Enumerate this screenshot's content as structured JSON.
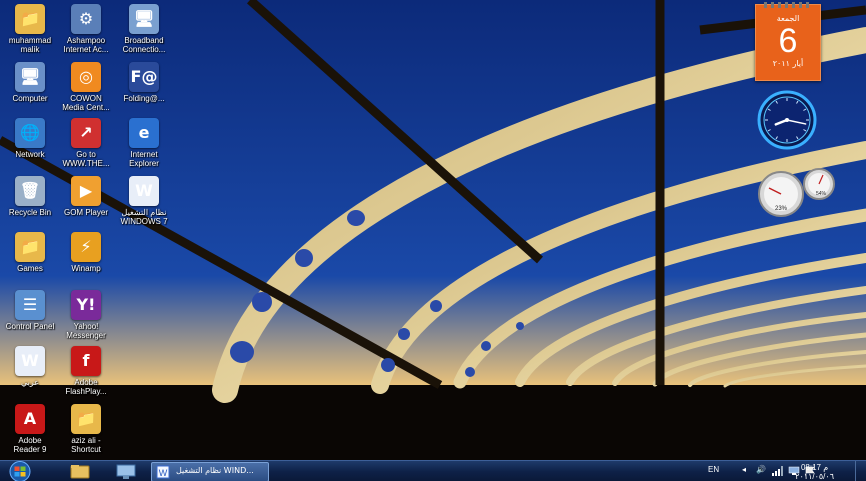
{
  "desktop": {
    "icons": [
      {
        "name": "user-folder",
        "label": "muhammad\nmalik",
        "icon": "folder-icon",
        "color": "#e8b84a",
        "glyph": "📁"
      },
      {
        "name": "ashampoo",
        "label": "Ashampoo\nInternet Ac...",
        "icon": "ashampoo-icon",
        "color": "#5a7fb8",
        "glyph": "⚙"
      },
      {
        "name": "broadband",
        "label": "Broadband\nConnectio...",
        "icon": "network-connection-icon",
        "color": "#7aa0d0",
        "glyph": "🖥"
      },
      {
        "name": "computer",
        "label": "Computer",
        "icon": "computer-icon",
        "color": "#6a90c8",
        "glyph": "🖥"
      },
      {
        "name": "cowon",
        "label": "COWON\nMedia Cent...",
        "icon": "cowon-icon",
        "color": "#f08a20",
        "glyph": "◎"
      },
      {
        "name": "folding",
        "label": "Folding@...",
        "icon": "folding-icon",
        "color": "#2a4a9a",
        "glyph": "F@"
      },
      {
        "name": "network",
        "label": "Network",
        "icon": "network-icon",
        "color": "#3a7ac8",
        "glyph": "🌐"
      },
      {
        "name": "goto-the",
        "label": "Go to\nWWW.THE...",
        "icon": "shortcut-icon",
        "color": "#d03030",
        "glyph": "↗"
      },
      {
        "name": "internet-explorer",
        "label": "Internet\nExplorer",
        "icon": "internet-explorer-icon",
        "color": "#2a70d0",
        "glyph": "e"
      },
      {
        "name": "recycle-bin",
        "label": "Recycle Bin",
        "icon": "recycle-bin-icon",
        "color": "#9ab0c8",
        "glyph": "🗑"
      },
      {
        "name": "gom-player",
        "label": "GOM Player",
        "icon": "gom-player-icon",
        "color": "#f0a030",
        "glyph": "▶"
      },
      {
        "name": "windows7-doc",
        "label": "نظام التشغيل\nWINDOWS 7",
        "icon": "document-icon",
        "color": "#e8eef8",
        "glyph": "W"
      },
      {
        "name": "games",
        "label": "Games",
        "icon": "folder-icon",
        "color": "#e8b84a",
        "glyph": "📁"
      },
      {
        "name": "winamp",
        "label": "Winamp",
        "icon": "winamp-icon",
        "color": "#e8a020",
        "glyph": "⚡"
      },
      {
        "name": "control-panel",
        "label": "Control Panel",
        "icon": "control-panel-icon",
        "color": "#5a90d0",
        "glyph": "☰"
      },
      {
        "name": "yahoo-messenger",
        "label": "Yahoo!\nMessenger",
        "icon": "yahoo-messenger-icon",
        "color": "#7a2a9a",
        "glyph": "Y!"
      },
      {
        "name": "arabic-doc",
        "label": "عربي",
        "icon": "word-document-icon",
        "color": "#e8eef8",
        "glyph": "W"
      },
      {
        "name": "flash-player",
        "label": "Adobe\nFlashPlay...",
        "icon": "flash-player-icon",
        "color": "#c81818",
        "glyph": "f"
      },
      {
        "name": "adobe-reader",
        "label": "Adobe\nReader 9",
        "icon": "adobe-reader-icon",
        "color": "#c81818",
        "glyph": "A"
      },
      {
        "name": "aziz-shortcut",
        "label": "aziz ali -\nShortcut",
        "icon": "folder-shortcut-icon",
        "color": "#e8b84a",
        "glyph": "📁"
      }
    ]
  },
  "gadgets": {
    "calendar": {
      "weekday": "الجمعة",
      "day": "6",
      "month_year": "أيار ٢٠١١"
    },
    "clock": {
      "hour": 8,
      "minute": 17
    },
    "cpu_meter": {
      "cpu": "23%",
      "memory": "54%"
    }
  },
  "taskbar": {
    "task_window_label": "نظام التشغيل WIND...",
    "language": "EN",
    "time": "08:17 م",
    "date": "٢٠١١/٠٥/٠٦"
  },
  "colors": {
    "taskbar": "#0e2148",
    "calendar": "#e8621b",
    "bridge": "#e8d8a0"
  }
}
